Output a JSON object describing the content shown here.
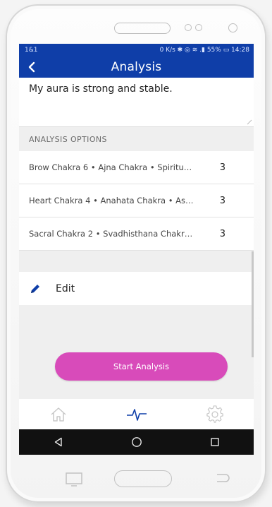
{
  "status_bar": {
    "carrier": "1&1",
    "indicators": "0 K/s ✱ ◎ ≋ .▮ 55% ▭ 14:28"
  },
  "app_bar": {
    "title": "Analysis",
    "back_icon": "chevron-left-icon"
  },
  "note": {
    "text": "My aura is strong and stable."
  },
  "analysis_options": {
    "header": "ANALYSIS OPTIONS",
    "items": [
      {
        "label": "Brow Chakra 6 • Ajna Chakra • Spiritual ...",
        "count": "3"
      },
      {
        "label": "Heart Chakra 4 • Anahata Chakra • Astr...",
        "count": "3"
      },
      {
        "label": "Sacral Chakra 2 • Svadhisthana Chakra •...",
        "count": "3"
      }
    ]
  },
  "edit": {
    "label": "Edit",
    "icon": "pencil-icon"
  },
  "start_button": {
    "label": "Start Analysis"
  },
  "tabbar": {
    "items": [
      "home-icon",
      "pulse-icon",
      "gear-icon"
    ],
    "active_index": 1
  },
  "colors": {
    "primary_blue": "#0f3ea8",
    "accent_pink": "#d84bba",
    "active_tab": "#0f3ea8",
    "inactive_tab": "#c8c8c8"
  }
}
